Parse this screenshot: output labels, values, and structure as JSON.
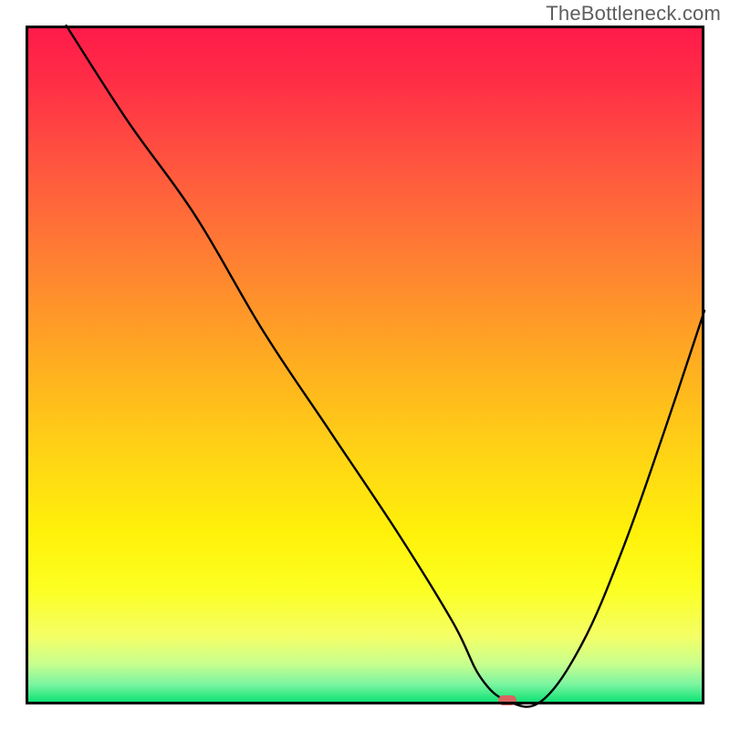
{
  "watermark": "TheBottleneck.com",
  "chart_data": {
    "type": "line",
    "title": "",
    "xlabel": "",
    "ylabel": "",
    "xlim": [
      0,
      100
    ],
    "ylim": [
      0,
      100
    ],
    "x": [
      6,
      15,
      25,
      35,
      45,
      55,
      63,
      67,
      71,
      76,
      82,
      88,
      94,
      100
    ],
    "values": [
      100,
      86,
      72,
      55,
      40,
      25,
      12,
      4,
      0.5,
      0.5,
      9,
      23,
      40,
      58
    ],
    "marker": {
      "x": 71,
      "y": 0.7
    },
    "grid": false,
    "legend": false
  },
  "colors": {
    "curve": "#000000",
    "frame": "#000000",
    "marker": "#d9645f"
  }
}
